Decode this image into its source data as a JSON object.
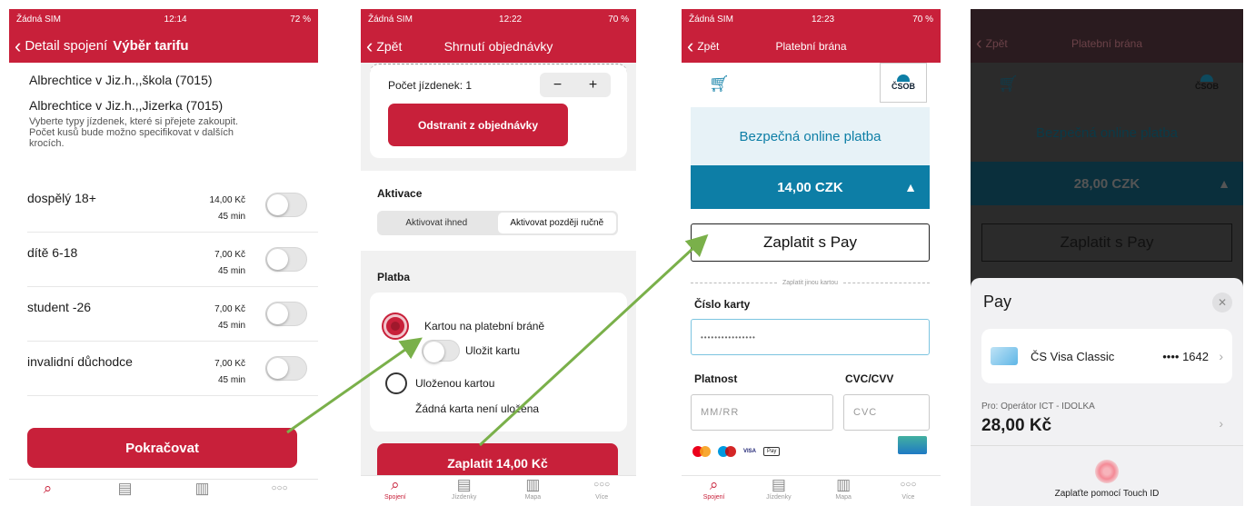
{
  "screen1": {
    "status": {
      "carrier": "Žádná SIM",
      "time": "12:14",
      "battery": "72 %"
    },
    "nav": {
      "back": "Detail spojení",
      "title": "Výběr tarifu"
    },
    "stops": [
      "Albrechtice v Jiz.h.,,škola (7015)",
      "Albrechtice v Jiz.h.,,Jizerka (7015)"
    ],
    "hint": "Vyberte typy jízdenek, které si přejete zakoupit. Počet kusů bude možno specifikovat v dalších krocích.",
    "tariffs": [
      {
        "name": "dospělý 18+",
        "price": "14,00 Kč",
        "duration": "45 min"
      },
      {
        "name": "dítě 6-18",
        "price": "7,00 Kč",
        "duration": "45 min"
      },
      {
        "name": "student -26",
        "price": "7,00 Kč",
        "duration": "45 min"
      },
      {
        "name": "invalidní důchodce",
        "price": "7,00 Kč",
        "duration": "45 min"
      }
    ],
    "continue": "Pokračovat"
  },
  "screen2": {
    "status": {
      "carrier": "Žádná SIM",
      "time": "12:22",
      "battery": "70 %"
    },
    "nav": {
      "back": "Zpět",
      "title": "Shrnutí objednávky"
    },
    "count_label": "Počet jízdenek: 1",
    "minus": "−",
    "plus": "+",
    "remove": "Odstranit z objednávky",
    "activation_title": "Aktivace",
    "activation_options": [
      "Aktivovat ihned",
      "Aktivovat později ručně"
    ],
    "payment_title": "Platba",
    "pay_gateway": "Kartou na platební bráně",
    "save_card": "Uložit kartu",
    "saved_card": "Uloženou kartou",
    "no_saved_card": "Žádná karta není uložena",
    "pay_button": "Zaplatit 14,00 Kč"
  },
  "screen3": {
    "status": {
      "carrier": "Žádná SIM",
      "time": "12:23",
      "battery": "70 %"
    },
    "nav": {
      "back": "Zpět",
      "title": "Platební brána"
    },
    "bank": "ČSOB",
    "secure": "Bezpečná online platba",
    "amount": "14,00 CZK",
    "apple_pay": "Zaplatit s  Pay",
    "other_card": "Zaplatit jinou kartou",
    "card_number_label": "Číslo karty",
    "card_number_value": "••••••••••••••••",
    "validity_label": "Platnost",
    "cvc_label": "CVC/CVV",
    "validity_placeholder": "MM/RR",
    "cvc_placeholder": "CVC",
    "card_brands": [
      "VISA",
      "Pay"
    ]
  },
  "screen4": {
    "nav": {
      "back": "Zpět",
      "title": "Platební brána"
    },
    "bank": "ČSOB",
    "secure": "Bezpečná online platba",
    "amount": "28,00 CZK",
    "apple_pay": "Zaplatit s  Pay",
    "sheet_title": "Pay",
    "card_name": "ČS Visa Classic",
    "card_last4": "•••• 1642",
    "merchant_label": "Pro: Operátor ICT - IDOLKA",
    "total": "28,00 Kč",
    "touch_id": "Zaplaťte pomocí Touch ID"
  },
  "tabbar": [
    "Spojení",
    "Jízdenky",
    "Mapa",
    "Více"
  ],
  "colors": {
    "brand_red": "#c8203a",
    "gateway_blue": "#0d7ea6",
    "arrow_green": "#7ab04a"
  }
}
